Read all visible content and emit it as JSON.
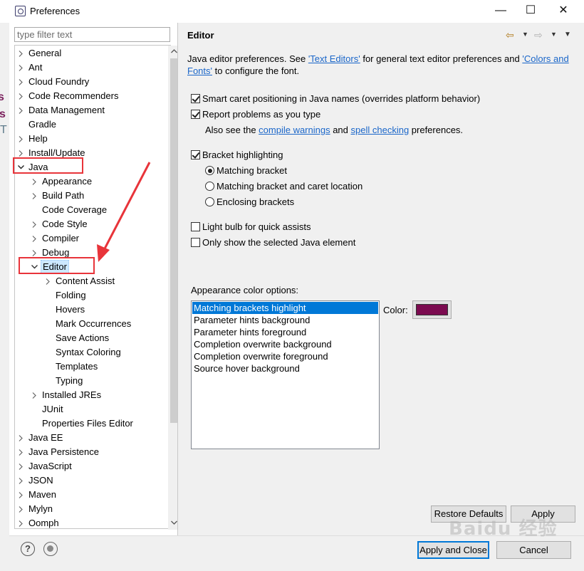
{
  "window": {
    "title": "Preferences",
    "minimize_glyph": "—",
    "maximize_glyph": "☐",
    "close_glyph": "✕"
  },
  "filter": {
    "placeholder": "type filter text",
    "value": ""
  },
  "tree": {
    "expanded_glyph": "chevron-down-icon",
    "collapsed_glyph": "chevron-right-icon",
    "items": [
      {
        "label": "General",
        "level": 0,
        "expander": "collapsed"
      },
      {
        "label": "Ant",
        "level": 0,
        "expander": "collapsed"
      },
      {
        "label": "Cloud Foundry",
        "level": 0,
        "expander": "collapsed"
      },
      {
        "label": "Code Recommenders",
        "level": 0,
        "expander": "collapsed"
      },
      {
        "label": "Data Management",
        "level": 0,
        "expander": "collapsed"
      },
      {
        "label": "Gradle",
        "level": 0,
        "expander": "none"
      },
      {
        "label": "Help",
        "level": 0,
        "expander": "collapsed"
      },
      {
        "label": "Install/Update",
        "level": 0,
        "expander": "collapsed"
      },
      {
        "label": "Java",
        "level": 0,
        "expander": "expanded"
      },
      {
        "label": "Appearance",
        "level": 1,
        "expander": "collapsed"
      },
      {
        "label": "Build Path",
        "level": 1,
        "expander": "collapsed"
      },
      {
        "label": "Code Coverage",
        "level": 1,
        "expander": "none"
      },
      {
        "label": "Code Style",
        "level": 1,
        "expander": "collapsed"
      },
      {
        "label": "Compiler",
        "level": 1,
        "expander": "collapsed"
      },
      {
        "label": "Debug",
        "level": 1,
        "expander": "collapsed"
      },
      {
        "label": "Editor",
        "level": 1,
        "expander": "expanded",
        "selected": true
      },
      {
        "label": "Content Assist",
        "level": 2,
        "expander": "collapsed"
      },
      {
        "label": "Folding",
        "level": 2,
        "expander": "none"
      },
      {
        "label": "Hovers",
        "level": 2,
        "expander": "none"
      },
      {
        "label": "Mark Occurrences",
        "level": 2,
        "expander": "none"
      },
      {
        "label": "Save Actions",
        "level": 2,
        "expander": "none"
      },
      {
        "label": "Syntax Coloring",
        "level": 2,
        "expander": "none"
      },
      {
        "label": "Templates",
        "level": 2,
        "expander": "none"
      },
      {
        "label": "Typing",
        "level": 2,
        "expander": "none"
      },
      {
        "label": "Installed JREs",
        "level": 1,
        "expander": "collapsed"
      },
      {
        "label": "JUnit",
        "level": 1,
        "expander": "none"
      },
      {
        "label": "Properties Files Editor",
        "level": 1,
        "expander": "none"
      },
      {
        "label": "Java EE",
        "level": 0,
        "expander": "collapsed"
      },
      {
        "label": "Java Persistence",
        "level": 0,
        "expander": "collapsed"
      },
      {
        "label": "JavaScript",
        "level": 0,
        "expander": "collapsed"
      },
      {
        "label": "JSON",
        "level": 0,
        "expander": "collapsed"
      },
      {
        "label": "Maven",
        "level": 0,
        "expander": "collapsed"
      },
      {
        "label": "Mylyn",
        "level": 0,
        "expander": "collapsed"
      },
      {
        "label": "Oomph",
        "level": 0,
        "expander": "collapsed"
      }
    ]
  },
  "page": {
    "title": "Editor",
    "desc": {
      "part1": "Java editor preferences. See ",
      "link1": "'Text Editors'",
      "part2": " for general text editor preferences and ",
      "link2": "'Colors and Fonts'",
      "part3": " to configure the font."
    },
    "options": {
      "smart_caret": {
        "label": "Smart caret positioning in Java names (overrides platform behavior)",
        "checked": true
      },
      "report_problems": {
        "label": "Report problems as you type",
        "checked": true
      },
      "also_see": {
        "prefix": "Also see the ",
        "link1": "compile warnings",
        "mid": " and ",
        "link2": "spell checking",
        "suffix": " preferences."
      },
      "bracket_highlighting": {
        "label": "Bracket highlighting",
        "checked": true
      },
      "radios": [
        {
          "label": "Matching bracket",
          "checked": true
        },
        {
          "label": "Matching bracket and caret location",
          "checked": false
        },
        {
          "label": "Enclosing brackets",
          "checked": false
        }
      ],
      "light_bulb": {
        "label": "Light bulb for quick assists",
        "checked": false
      },
      "only_show_selected": {
        "label": "Only show the selected Java element",
        "checked": false
      }
    },
    "appearance": {
      "label": "Appearance color options:",
      "items": [
        "Matching brackets highlight",
        "Parameter hints background",
        "Parameter hints foreground",
        "Completion overwrite background",
        "Completion overwrite foreground",
        "Source hover background"
      ],
      "selected_index": 0,
      "color_label": "Color:",
      "color_value": "#7b0a4f"
    },
    "buttons": {
      "restore_defaults": "Restore Defaults",
      "apply": "Apply"
    }
  },
  "footer": {
    "apply_and_close": "Apply and Close",
    "cancel": "Cancel",
    "help_glyph": "?"
  },
  "watermark": "Baidu 经验",
  "colors": {
    "annotation_red": "#e8343a",
    "link_blue": "#1a66c9",
    "selection_blue": "#0078d7"
  }
}
